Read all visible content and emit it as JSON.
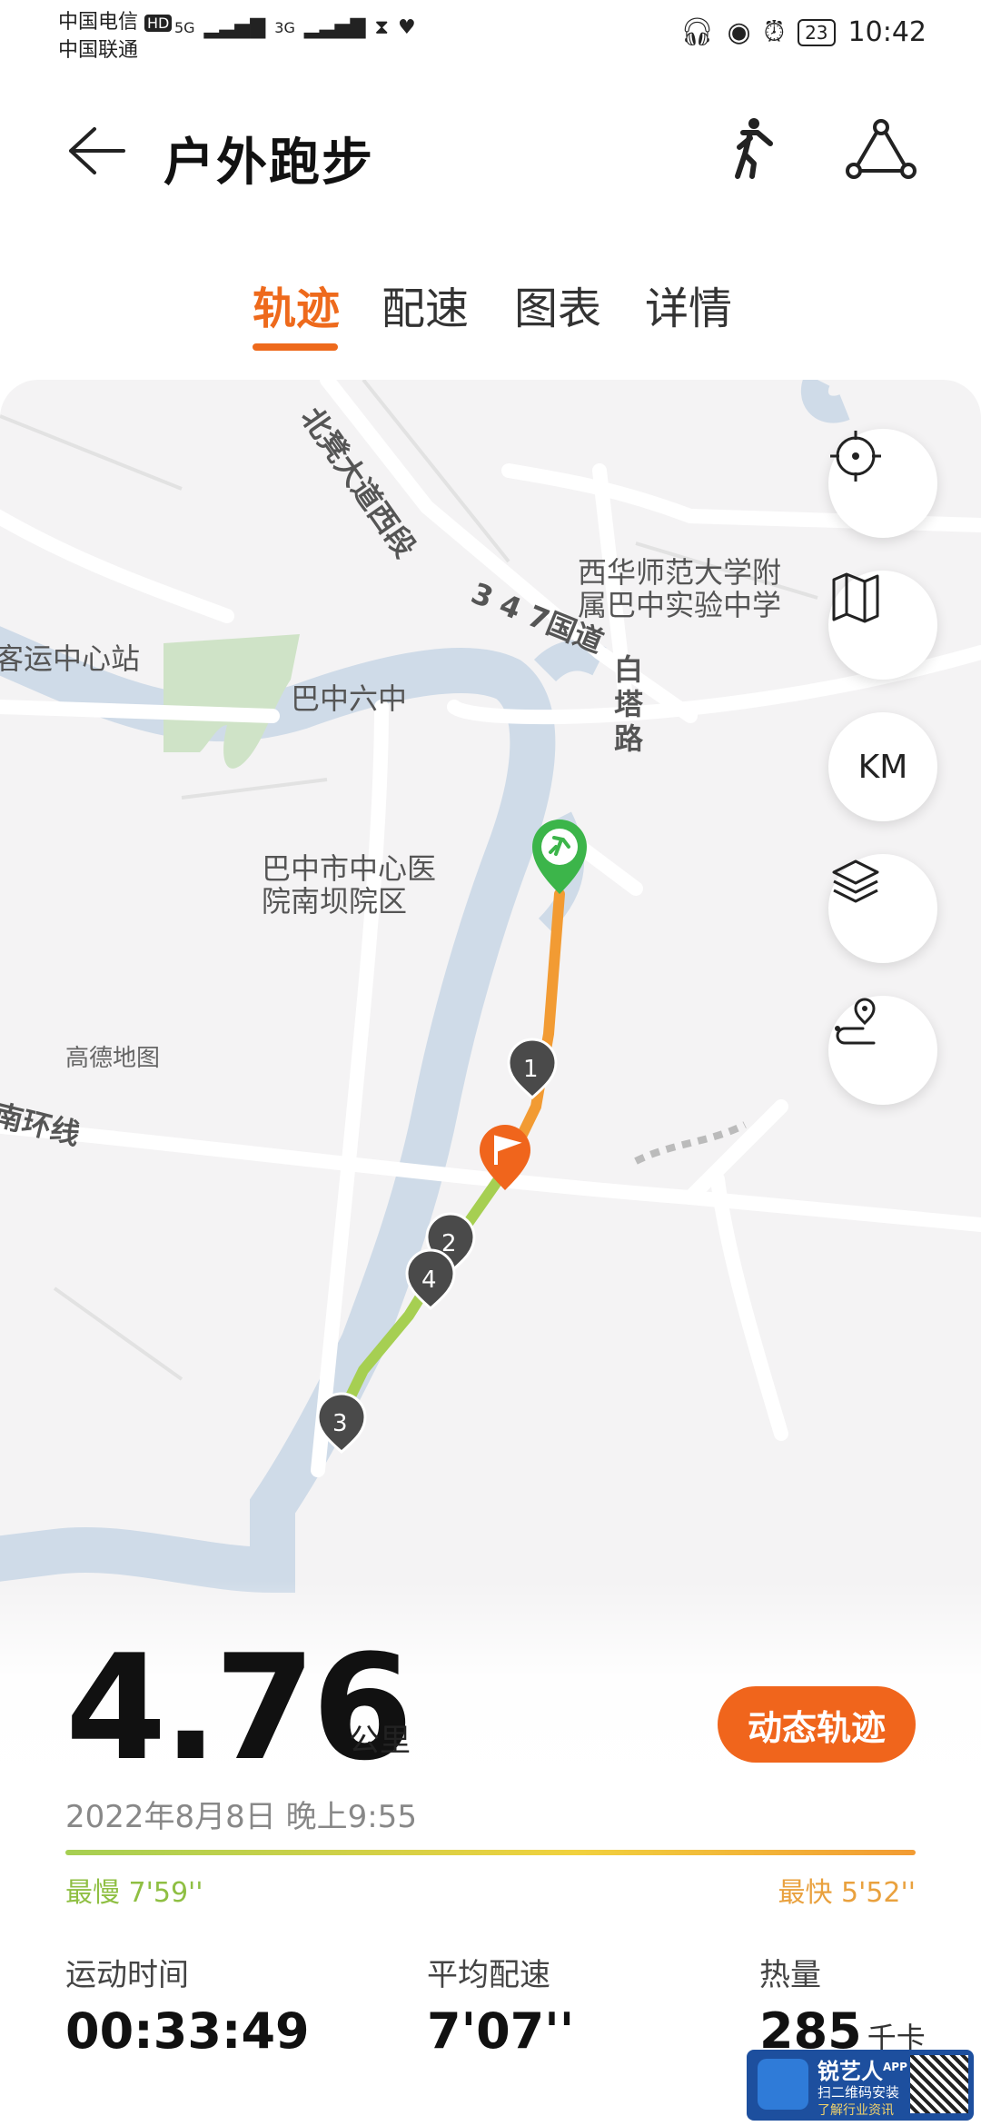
{
  "status_bar": {
    "carrier1": "中国电信",
    "carrier1_badge": "HD",
    "carrier2": "中国联通",
    "net1": "5G",
    "net2": "3G",
    "battery": "23",
    "time": "10:42"
  },
  "header": {
    "title": "户外跑步"
  },
  "tabs": [
    {
      "label": "轨迹",
      "active": true
    },
    {
      "label": "配速",
      "active": false
    },
    {
      "label": "图表",
      "active": false
    },
    {
      "label": "详情",
      "active": false
    }
  ],
  "map": {
    "labels": {
      "road_north": "北凳大道西段",
      "road_347": "3 4 7国道",
      "station": "客运中心站",
      "school": "西华师范大学附\n属巴中实验中学",
      "road_baita": "白塔路",
      "school2": "巴中六中",
      "hospital": "巴中市中心医\n院南坝院区",
      "attribution": "高德地图",
      "ring_road": "南环线"
    },
    "km_markers": [
      "1",
      "2",
      "4",
      "3"
    ],
    "km_button": "KM"
  },
  "summary": {
    "distance": "4.76",
    "distance_unit": "公里",
    "dynamic_track_button": "动态轨迹",
    "datetime": "2022年8月8日 晚上9:55",
    "slowest": "最慢 7'59''",
    "fastest": "最快 5'52''"
  },
  "stats": [
    {
      "label": "运动时间",
      "value": "00:33:49",
      "unit": ""
    },
    {
      "label": "平均配速",
      "value": "7'07''",
      "unit": ""
    },
    {
      "label": "热量",
      "value": "285",
      "unit": "千卡"
    }
  ],
  "watermark": {
    "name": "锐艺人",
    "app": "APP",
    "line1": "扫二维码安装",
    "line2": "了解行业资讯"
  },
  "colors": {
    "accent": "#f0651c",
    "route_orange": "#f29b33",
    "route_green": "#a6cf52",
    "start_green": "#3cb54a",
    "marker_dark": "#4a4a4a",
    "river": "#cfdbe8"
  }
}
